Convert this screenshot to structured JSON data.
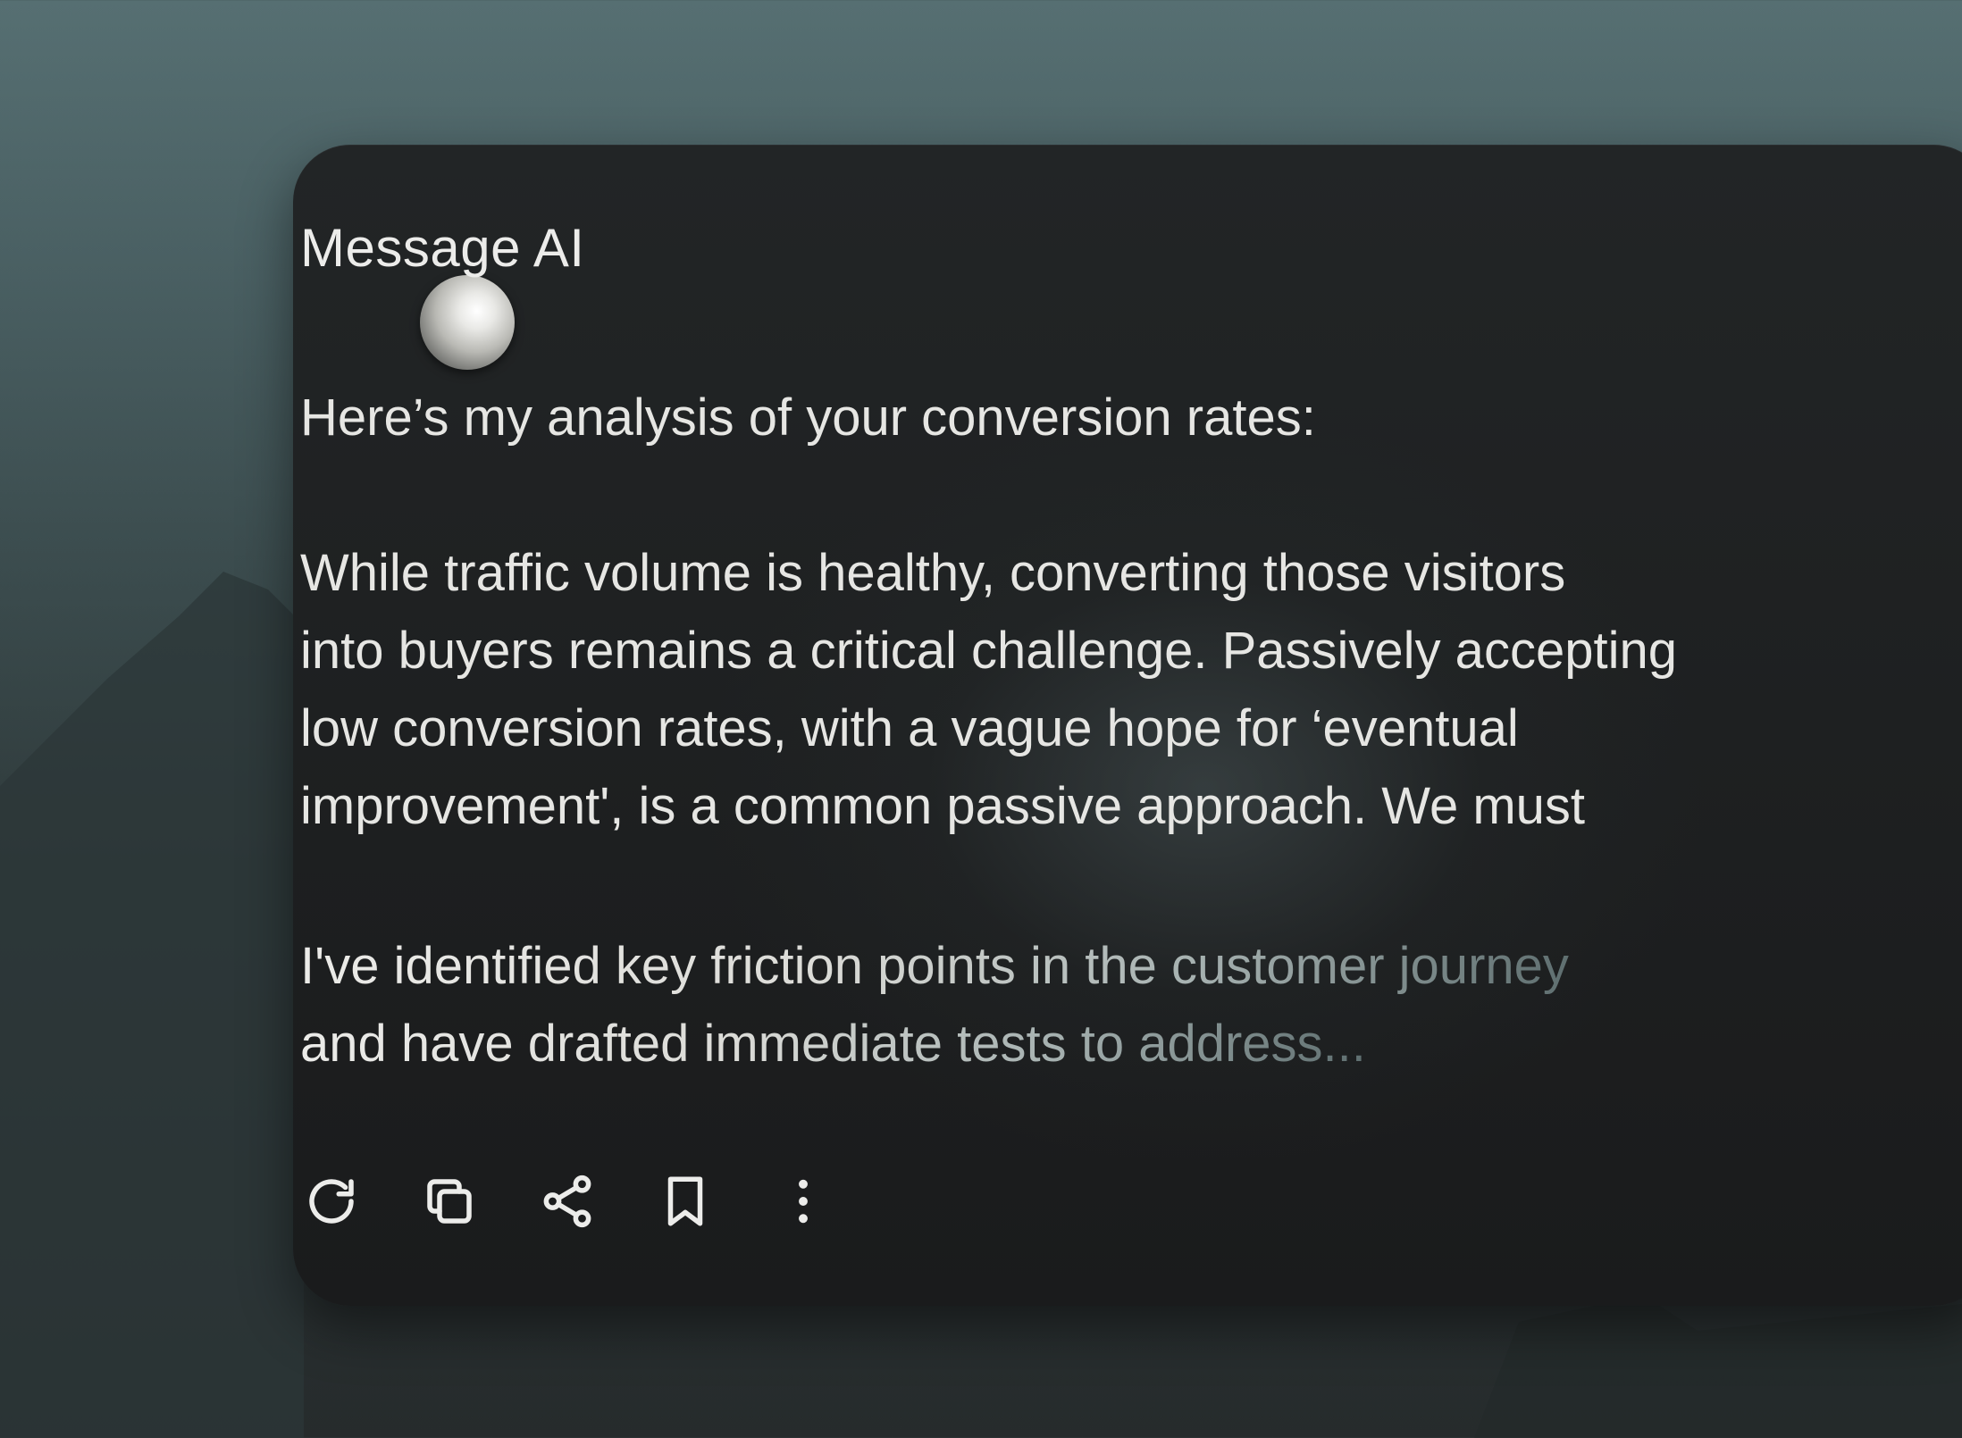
{
  "message": {
    "sender": "Message AI",
    "intro": "Here’s my analysis of your conversion rates:",
    "body_lines": [
      "While traffic volume is healthy, converting those visitors",
      "into buyers remains a critical challenge. Passively accepting",
      "low conversion rates, with a vague hope for ‘eventual",
      "improvement', is a common passive approach. We must"
    ],
    "faded_lines": [
      "I've identified key friction points in the customer journey",
      "and have drafted immediate tests to address..."
    ]
  },
  "actions": [
    {
      "name": "regenerate",
      "icon": "refresh-icon"
    },
    {
      "name": "copy",
      "icon": "copy-icon"
    },
    {
      "name": "share",
      "icon": "share-icon"
    },
    {
      "name": "bookmark",
      "icon": "bookmark-icon"
    },
    {
      "name": "more",
      "icon": "more-vertical-icon"
    }
  ],
  "colors": {
    "card_background": "#1e2021",
    "text": "#e6e6e3",
    "page_background_top": "#566f72",
    "page_background_bottom": "#262b2c"
  }
}
